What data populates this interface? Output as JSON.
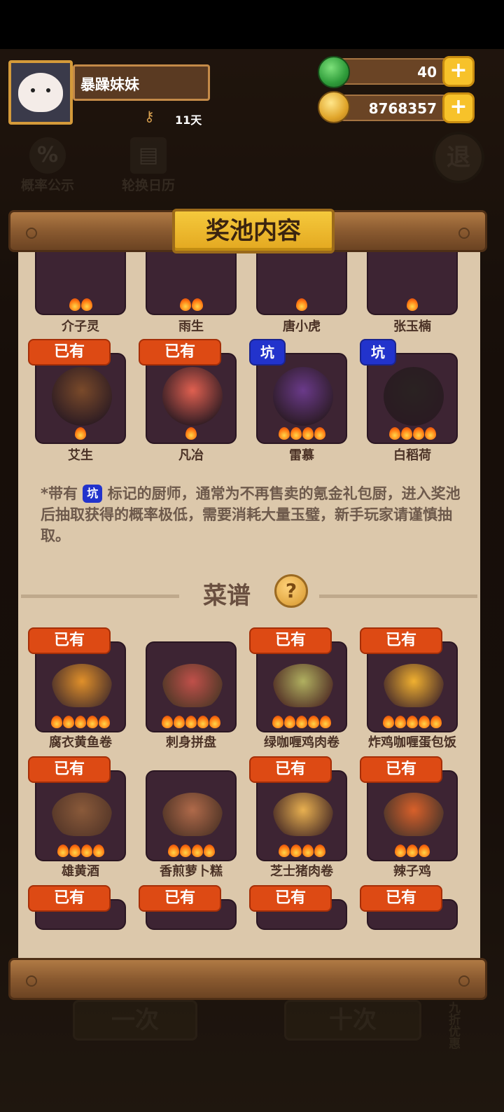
{
  "player": {
    "name": "暴躁妹妹",
    "days": "11天"
  },
  "currency": {
    "jade": "40",
    "gold": "8768357"
  },
  "background_buttons": {
    "probability": "概率公示",
    "calendar": "轮换日历",
    "exit": "退"
  },
  "panel": {
    "title": "奖池内容"
  },
  "tags": {
    "owned": "已有",
    "pit": "坑"
  },
  "chefs_partial": [
    {
      "name": "介子灵",
      "flames": 2
    },
    {
      "name": "雨生",
      "flames": 2
    },
    {
      "name": "唐小虎",
      "flames": 1
    },
    {
      "name": "张玉楠",
      "flames": 1
    }
  ],
  "chefs": [
    {
      "name": "艾生",
      "flames": 1,
      "tag": "owned",
      "color": "#7a4a2a"
    },
    {
      "name": "凡冶",
      "flames": 1,
      "tag": "owned",
      "color": "#e06050"
    },
    {
      "name": "雷慕",
      "flames": 4,
      "tag": "pit",
      "color": "#6a3a8a"
    },
    {
      "name": "白稻荷",
      "flames": 4,
      "tag": "pit",
      "color": "#2a2222"
    }
  ],
  "notice": {
    "prefix": "*带有",
    "badge": "坑",
    "text": "标记的厨师，通常为不再售卖的氪金礼包厨，进入奖池后抽取获得的概率极低，需要消耗大量玉璧，新手玩家请谨慎抽取。"
  },
  "recipes_title": "菜谱",
  "help_icon": "?",
  "recipes": [
    {
      "name": "腐衣黄鱼卷",
      "flames": 5,
      "owned": true,
      "color": "#e0902a"
    },
    {
      "name": "刺身拼盘",
      "flames": 5,
      "owned": false,
      "color": "#c0504a"
    },
    {
      "name": "绿咖喱鸡肉卷",
      "flames": 5,
      "owned": true,
      "color": "#b0b060"
    },
    {
      "name": "炸鸡咖喱蛋包饭",
      "flames": 5,
      "owned": true,
      "color": "#f0b030"
    },
    {
      "name": "雄黄酒",
      "flames": 4,
      "owned": true,
      "color": "#8a5a3a"
    },
    {
      "name": "香煎萝卜糕",
      "flames": 4,
      "owned": false,
      "color": "#b06a4a"
    },
    {
      "name": "芝士猪肉卷",
      "flames": 4,
      "owned": true,
      "color": "#e8b050"
    },
    {
      "name": "辣子鸡",
      "flames": 3,
      "owned": true,
      "color": "#d8602a"
    }
  ],
  "recipes_partial": [
    {
      "owned": true
    },
    {
      "owned": true
    },
    {
      "owned": true
    },
    {
      "owned": true
    }
  ],
  "bottom": {
    "once": "一次",
    "ten": "十次",
    "discount": "九折优惠"
  }
}
